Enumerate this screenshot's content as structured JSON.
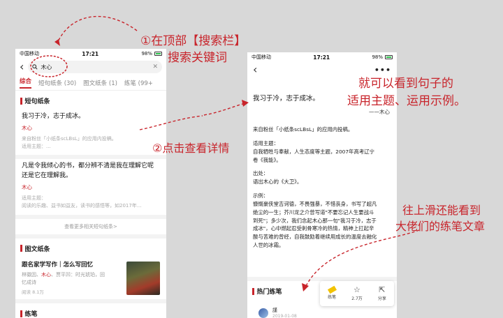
{
  "annotations": {
    "step1_line1": "①在顶部【搜索栏】",
    "step1_line2": "搜索关键词",
    "step2": "②点击查看详情",
    "result_line1": "就可以看到句子的",
    "result_line2": "适用主题、运用示例。",
    "scroll_line1": "往上滑还能看到",
    "scroll_line2": "大佬们的练笔文章"
  },
  "status_bar": {
    "carrier": "中国移动",
    "time": "17:21",
    "battery": "98%"
  },
  "search": {
    "query": "木心"
  },
  "tabs": [
    {
      "label": "综合"
    },
    {
      "label": "短句纸条 (30)"
    },
    {
      "label": "图文纸条 (1)"
    },
    {
      "label": "练笔 (99+"
    }
  ],
  "short_sentence_section": {
    "title": "短句纸条",
    "cards": [
      {
        "quote": "我习于冷，志于成冰。",
        "author": "木心",
        "meta_line1": "来自粉丝「小纸条scLBsL」的应用内投稿。",
        "meta_line2": "适用主题：..."
      },
      {
        "quote_line1": "凡是令我倾心的书，都分辨不清是我在理解它呢",
        "quote_line2": "还是它在理解我。",
        "author": "木心",
        "meta_line1": "适用主题：",
        "meta_line2": "阅读的乐趣、益书如益友，读书的感悟等，如2017年..."
      }
    ],
    "more_link": "查看更多相关短句纸条>"
  },
  "image_text_section": {
    "title": "图文纸条",
    "article": {
      "title": "跟名家学写作｜怎么写回忆",
      "authors_prefix": "林徽因、",
      "authors_highlight": "木心",
      "authors_suffix": "、贾平凹：时光琥珀，回",
      "authors_line2": "忆成诗",
      "reads": "阅读 8.1万"
    }
  },
  "practice_section_title": "练笔",
  "detail": {
    "quote": "我习于冷，志于成冰。",
    "author": "——木心",
    "source": "来自粉丝「小纸条scLBsL」的应用内投稿。",
    "theme_label": "适用主题：",
    "theme_line1": "自我牺牲与奉献，人生态度等主题，2007年高考辽宁",
    "theme_line2": "卷《我能》。",
    "origin_label": "出处：",
    "origin_text": "语出木心的《大卫》。",
    "example_label": "示例：",
    "example_lines": [
      "慷慨豪侠堂吉诃德，不畏强暴，不惜丧身，书写了超凡",
      "绝尘的一生；芥川龙之介曾写道\"不要忘记人生要战斗",
      "到死\"；多少次，我们念起木心那一句\"我习于冷，志于",
      "成冰\"，心中燃起忍受刺骨寒冷的热情，精神上扛起辛",
      "酸与苦难的曾经，自我鼓励着继续用成长的温度去融化",
      "人世的冰霜。"
    ],
    "hot_section_title": "热门练笔",
    "writer_name": "謹",
    "writer_date": "2019-01-08",
    "actions": {
      "practice": "练笔",
      "favorites": "2.7万",
      "share": "分享"
    }
  },
  "colors": {
    "accent": "#c8242b",
    "background": "#d8d8d8"
  }
}
